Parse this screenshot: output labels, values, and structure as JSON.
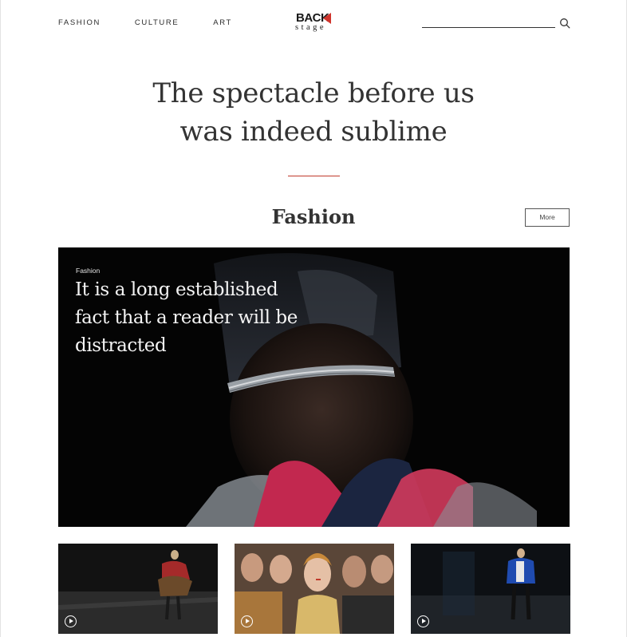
{
  "header": {
    "nav": [
      "FASHION",
      "CULTURE",
      "ART"
    ],
    "logo_top": "BACK",
    "logo_bottom": "stage",
    "search_icon": "search-icon"
  },
  "hero": {
    "title_line1": "The spectacle before us",
    "title_line2": "was indeed sublime"
  },
  "section": {
    "title": "Fashion",
    "more_label": "More"
  },
  "feature": {
    "tag": "Fashion",
    "headline": "It is a long established fact that a reader will be distracted"
  },
  "thumbnails": [
    {
      "icon": "play-icon"
    },
    {
      "icon": "play-icon"
    },
    {
      "icon": "play-icon"
    }
  ],
  "colors": {
    "accent": "#c0392b",
    "text": "#333333"
  }
}
